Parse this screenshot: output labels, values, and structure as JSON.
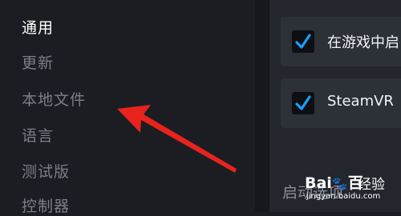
{
  "sidebar": {
    "items": [
      {
        "label": "通用"
      },
      {
        "label": "更新"
      },
      {
        "label": "本地文件"
      },
      {
        "label": "语言"
      },
      {
        "label": "测试版"
      },
      {
        "label": "控制器"
      }
    ]
  },
  "main": {
    "options": [
      {
        "label": "在游戏中启",
        "checked": true
      },
      {
        "label": "SteamVR",
        "checked": true
      }
    ],
    "section_title": "启动选项"
  },
  "watermark": {
    "brand": "Bai",
    "brand_suffix": "百",
    "jingyan": "经验",
    "url": "jingyan.baidu.com"
  },
  "colors": {
    "accent": "#1a9fff",
    "arrow": "#e8231d"
  }
}
